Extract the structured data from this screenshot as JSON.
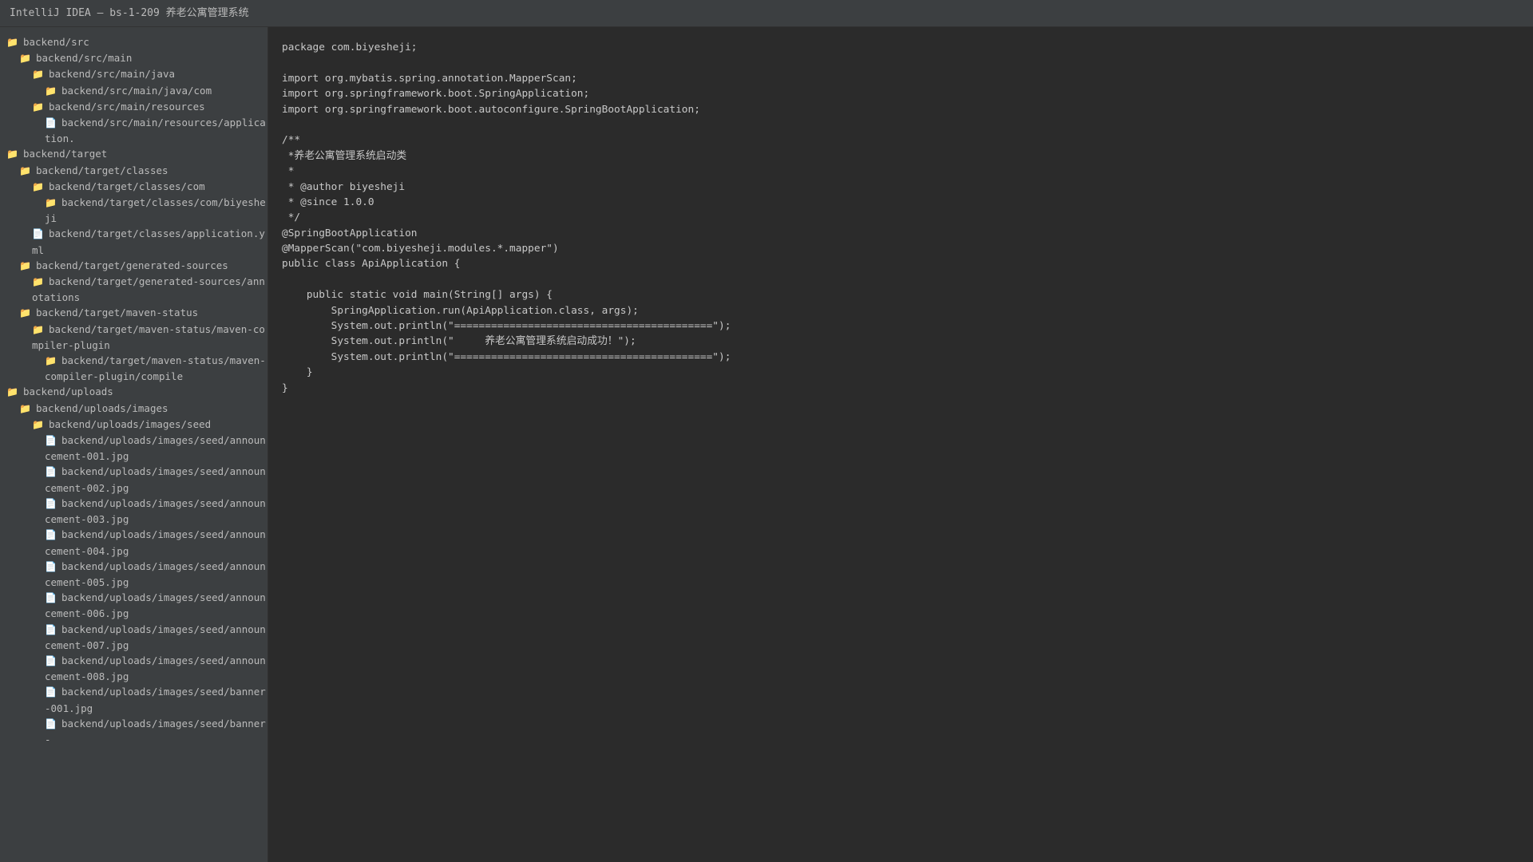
{
  "window": {
    "title": "IntelliJ IDEA — bs-1-209 养老公寓管理系统"
  },
  "project_tree": [
    {
      "label": "backend/src",
      "type": "folder",
      "depth": 0
    },
    {
      "label": "backend/src/main",
      "type": "folder",
      "depth": 1
    },
    {
      "label": "backend/src/main/java",
      "type": "folder",
      "depth": 2
    },
    {
      "label": "backend/src/main/java/com",
      "type": "folder",
      "depth": 3
    },
    {
      "label": "backend/src/main/resources",
      "type": "folder",
      "depth": 2
    },
    {
      "label": "backend/src/main/resources/application.",
      "type": "file",
      "depth": 3
    },
    {
      "label": "backend/target",
      "type": "folder",
      "depth": 0
    },
    {
      "label": "backend/target/classes",
      "type": "folder",
      "depth": 1
    },
    {
      "label": "backend/target/classes/com",
      "type": "folder",
      "depth": 2
    },
    {
      "label": "backend/target/classes/com/biyesheji",
      "type": "folder",
      "depth": 3
    },
    {
      "label": "backend/target/classes/application.yml",
      "type": "file",
      "depth": 2
    },
    {
      "label": "backend/target/generated-sources",
      "type": "folder",
      "depth": 1
    },
    {
      "label": "backend/target/generated-sources/annotations",
      "type": "folder",
      "depth": 2
    },
    {
      "label": "backend/target/maven-status",
      "type": "folder",
      "depth": 1
    },
    {
      "label": "backend/target/maven-status/maven-compiler-plugin",
      "type": "folder",
      "depth": 2
    },
    {
      "label": "backend/target/maven-status/maven-compiler-plugin/compile",
      "type": "folder",
      "depth": 3
    },
    {
      "label": "backend/uploads",
      "type": "folder",
      "depth": 0
    },
    {
      "label": "backend/uploads/images",
      "type": "folder",
      "depth": 1
    },
    {
      "label": "backend/uploads/images/seed",
      "type": "folder",
      "depth": 2
    },
    {
      "label": "backend/uploads/images/seed/announcement-001.jpg",
      "type": "file",
      "depth": 3
    },
    {
      "label": "backend/uploads/images/seed/announcement-002.jpg",
      "type": "file",
      "depth": 3
    },
    {
      "label": "backend/uploads/images/seed/announcement-003.jpg",
      "type": "file",
      "depth": 3
    },
    {
      "label": "backend/uploads/images/seed/announcement-004.jpg",
      "type": "file",
      "depth": 3
    },
    {
      "label": "backend/uploads/images/seed/announcement-005.jpg",
      "type": "file",
      "depth": 3
    },
    {
      "label": "backend/uploads/images/seed/announcement-006.jpg",
      "type": "file",
      "depth": 3
    },
    {
      "label": "backend/uploads/images/seed/announcement-007.jpg",
      "type": "file",
      "depth": 3
    },
    {
      "label": "backend/uploads/images/seed/announcement-008.jpg",
      "type": "file",
      "depth": 3
    },
    {
      "label": "backend/uploads/images/seed/banner-001.jpg",
      "type": "file",
      "depth": 3
    },
    {
      "label": "backend/uploads/images/seed/banner-",
      "type": "file",
      "depth": 3
    }
  ],
  "editor": {
    "lines": [
      "package com.biyesheji;",
      "",
      "import org.mybatis.spring.annotation.MapperScan;",
      "import org.springframework.boot.SpringApplication;",
      "import org.springframework.boot.autoconfigure.SpringBootApplication;",
      "",
      "/**",
      " *养老公寓管理系统启动类",
      " *",
      " * @author biyesheji",
      " * @since 1.0.0",
      " */",
      "@SpringBootApplication",
      "@MapperScan(\"com.biyesheji.modules.*.mapper\")",
      "public class ApiApplication {",
      "",
      "    public static void main(String[] args) {",
      "        SpringApplication.run(ApiApplication.class, args);",
      "        System.out.println(\"==========================================\");",
      "        System.out.println(\"     养老公寓管理系统启动成功！\");",
      "        System.out.println(\"==========================================\");",
      "    }",
      "}"
    ]
  },
  "icons": {
    "folder": "folder-icon",
    "file": "file-icon"
  },
  "colors": {
    "folder_icon": "#e8bf6a",
    "sidebar_bg": "#3c3f41",
    "editor_bg": "#2b2b2b",
    "text": "#bbbbbb"
  }
}
